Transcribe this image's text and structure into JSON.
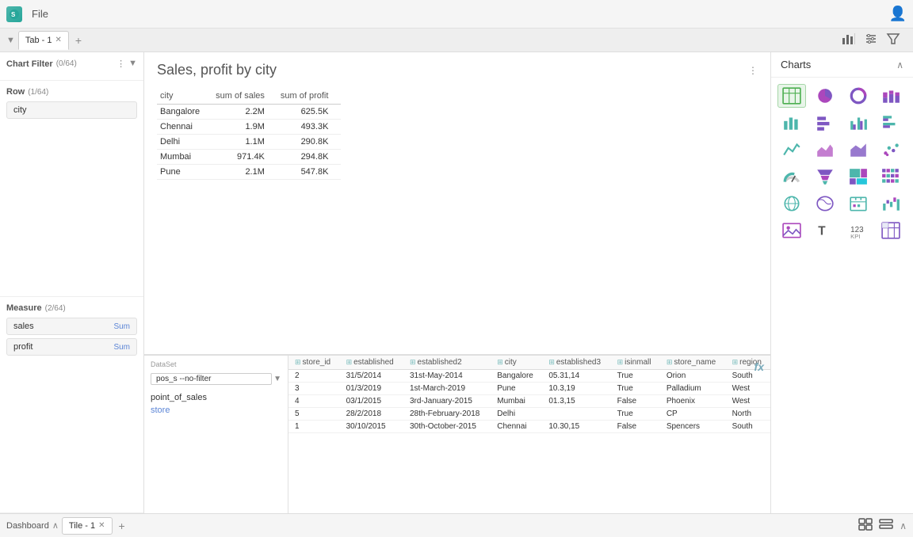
{
  "app": {
    "title": "File",
    "user_icon": "person"
  },
  "tabs": [
    {
      "label": "Tab - 1",
      "active": true
    }
  ],
  "toolbar": {
    "bar_icon": "📊",
    "filter_icon": "🔽",
    "funnel_icon": "⬇"
  },
  "left_panel": {
    "chart_filter": {
      "title": "Chart Filter",
      "count": "(0/64)"
    },
    "row": {
      "title": "Row",
      "count": "(1/64)",
      "field": "city"
    },
    "measure": {
      "title": "Measure",
      "count": "(2/64)",
      "fields": [
        {
          "name": "sales",
          "agg": "Sum"
        },
        {
          "name": "profit",
          "agg": "Sum"
        }
      ]
    }
  },
  "chart": {
    "title": "Sales, profit by city",
    "table": {
      "headers": [
        "city",
        "sum of sales",
        "sum of profit"
      ],
      "rows": [
        [
          "Bangalore",
          "2.2M",
          "625.5K"
        ],
        [
          "Chennai",
          "1.9M",
          "493.3K"
        ],
        [
          "Delhi",
          "1.1M",
          "290.8K"
        ],
        [
          "Mumbai",
          "971.4K",
          "294.8K"
        ],
        [
          "Pune",
          "2.1M",
          "547.8K"
        ]
      ]
    }
  },
  "dataset": {
    "label": "DataSet",
    "value": "pos_s --no-filter",
    "sources": [
      "point_of_sales",
      "store"
    ]
  },
  "bottom_table": {
    "columns": [
      "store_id",
      "established",
      "established2",
      "city",
      "established3",
      "isinmall",
      "store_name",
      "region"
    ],
    "rows": [
      [
        "2",
        "31/5/2014",
        "31st-May-2014",
        "Bangalore",
        "05.31,14",
        "True",
        "Orion",
        "South"
      ],
      [
        "3",
        "01/3/2019",
        "1st-March-2019",
        "Pune",
        "10.3,19",
        "True",
        "Palladium",
        "West"
      ],
      [
        "4",
        "03/1/2015",
        "3rd-January-2015",
        "Mumbai",
        "01.3,15",
        "False",
        "Phoenix",
        "West"
      ],
      [
        "5",
        "28/2/2018",
        "28th-February-2018",
        "Delhi",
        "",
        "True",
        "CP",
        "North"
      ],
      [
        "1",
        "30/10/2015",
        "30th-October-2015",
        "Chennai",
        "10.30,15",
        "False",
        "Spencers",
        "South"
      ]
    ]
  },
  "charts_panel": {
    "title": "Charts",
    "icons": [
      "table-chart",
      "pie-chart",
      "donut-chart",
      "stacked-bar",
      "bar-chart",
      "horizontal-bar",
      "grouped-bar",
      "horizontal-grouped",
      "line-chart",
      "area-chart",
      "filled-area",
      "scatter",
      "gauge",
      "funnel",
      "treemap",
      "heatmap",
      "globe",
      "world-map",
      "calendar",
      "waterfall",
      "image",
      "text",
      "number",
      "cross-tab"
    ]
  },
  "bottom_bar": {
    "dashboard_label": "Dashboard",
    "tile_label": "Tile - 1"
  }
}
